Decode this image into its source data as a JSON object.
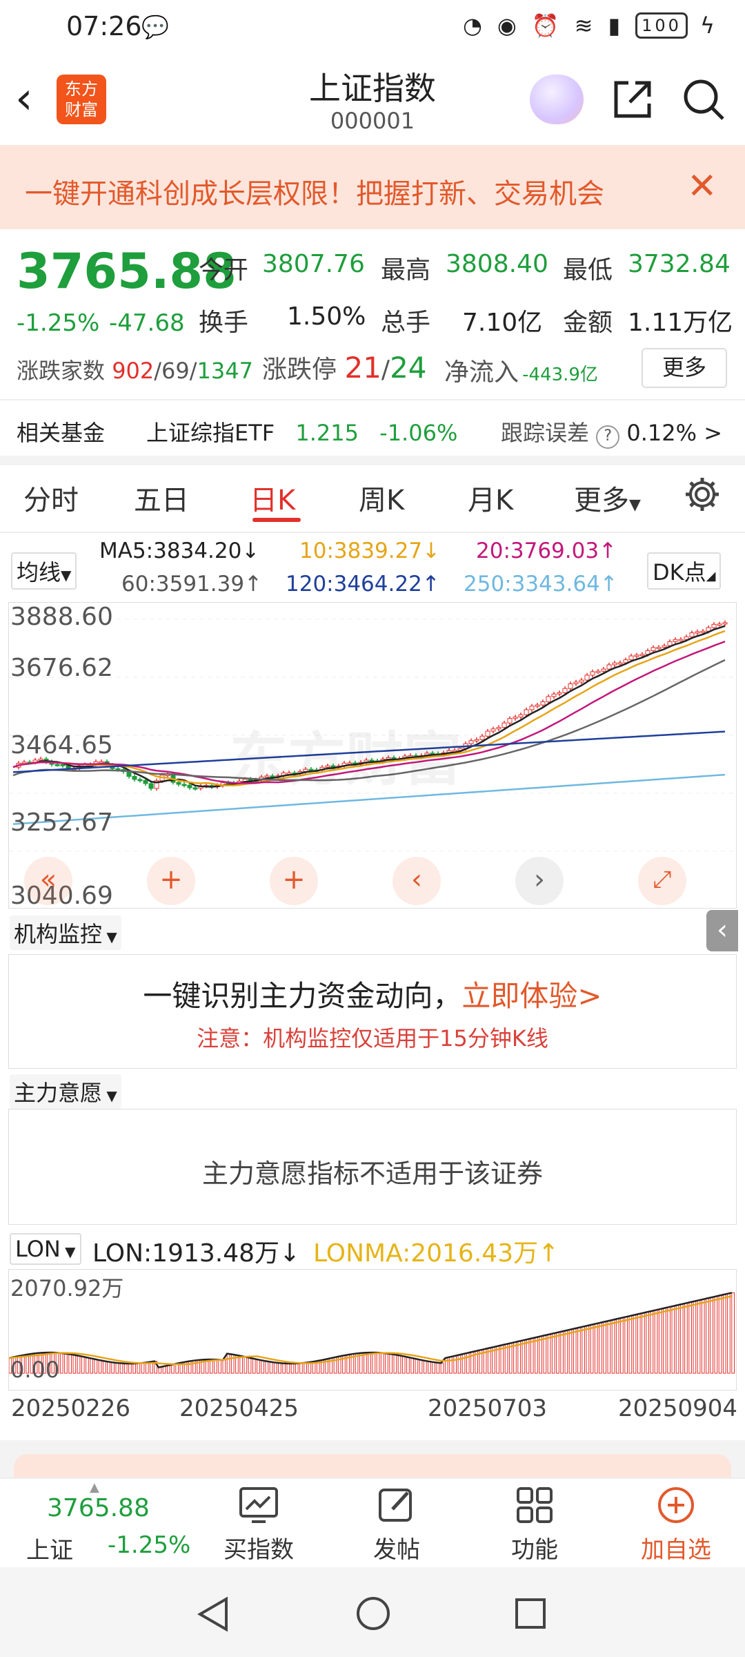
{
  "statusbar": {
    "time": "07:26",
    "battery": "100"
  },
  "header": {
    "title": "上证指数",
    "code": "000001",
    "logo_line1": "东方",
    "logo_line2": "财富"
  },
  "banner": {
    "text": "一键开通科创成长层权限！把握打新、交易机会"
  },
  "quote": {
    "price": "3765.88",
    "change_pct": "-1.25%",
    "change": "-47.68",
    "open_label": "今开",
    "open": "3807.76",
    "high_label": "最高",
    "high": "3808.40",
    "low_label": "最低",
    "low": "3732.84",
    "turnover_label": "换手",
    "turnover": "1.50%",
    "volume_label": "总手",
    "volume": "7.10亿",
    "amount_label": "金额",
    "amount": "1.11万亿",
    "breadth_label": "涨跌家数",
    "breadth_up": "902",
    "breadth_flat": "69",
    "breadth_down": "1347",
    "limit_label": "涨跌停",
    "limit_up": "21",
    "limit_down": "24",
    "inflow_label": "净流入",
    "inflow": "-443.9亿",
    "more": "更多"
  },
  "fund": {
    "label": "相关基金",
    "name": "上证综指ETF",
    "price": "1.215",
    "pct": "-1.06%",
    "tracking_label": "跟踪误差",
    "tracking": "0.12%",
    "arrow": ">"
  },
  "tabs": [
    "分时",
    "五日",
    "日K",
    "周K",
    "月K",
    "更多"
  ],
  "ma": {
    "selector": "均线",
    "dk": "DK点",
    "ma5": "MA5:3834.20↓",
    "ma10": "10:3839.27↓",
    "ma20": "20:3769.03↑",
    "ma60": "60:3591.39↑",
    "ma120": "120:3464.22↑",
    "ma250": "250:3343.64↑"
  },
  "kchart": {
    "y1": "3888.60",
    "y2": "3676.62",
    "y3": "3464.65",
    "y4": "3252.67",
    "y5": "3040.69",
    "watermark": "东方财富"
  },
  "colors": {
    "up": "#e2302b",
    "down": "#1e9e3c",
    "ma5": "#222222",
    "ma10": "#e6a417",
    "ma20": "#c2187b",
    "ma60": "#666666",
    "ma120": "#1f3f9a",
    "ma250": "#6fb8e0"
  },
  "institution": {
    "selector": "机构监控",
    "main": "一键识别主力资金动向，",
    "cta": "立即体验>",
    "note": "注意：机构监控仅适用于15分钟K线"
  },
  "intent": {
    "selector": "主力意愿",
    "message": "主力意愿指标不适用于该证券"
  },
  "lon": {
    "selector": "LON",
    "lon": "LON:1913.48万↓",
    "lonma": "LONMA:2016.43万↑",
    "ytop": "2070.92万",
    "ybottom": "0.00",
    "dates": [
      "20250226",
      "20250425",
      "20250703",
      "20250904"
    ]
  },
  "bottom": {
    "index_price": "3765.88",
    "index_name": "上证",
    "index_pct": "-1.25%",
    "buy": "买指数",
    "post": "发帖",
    "func": "功能",
    "add": "加自选"
  }
}
